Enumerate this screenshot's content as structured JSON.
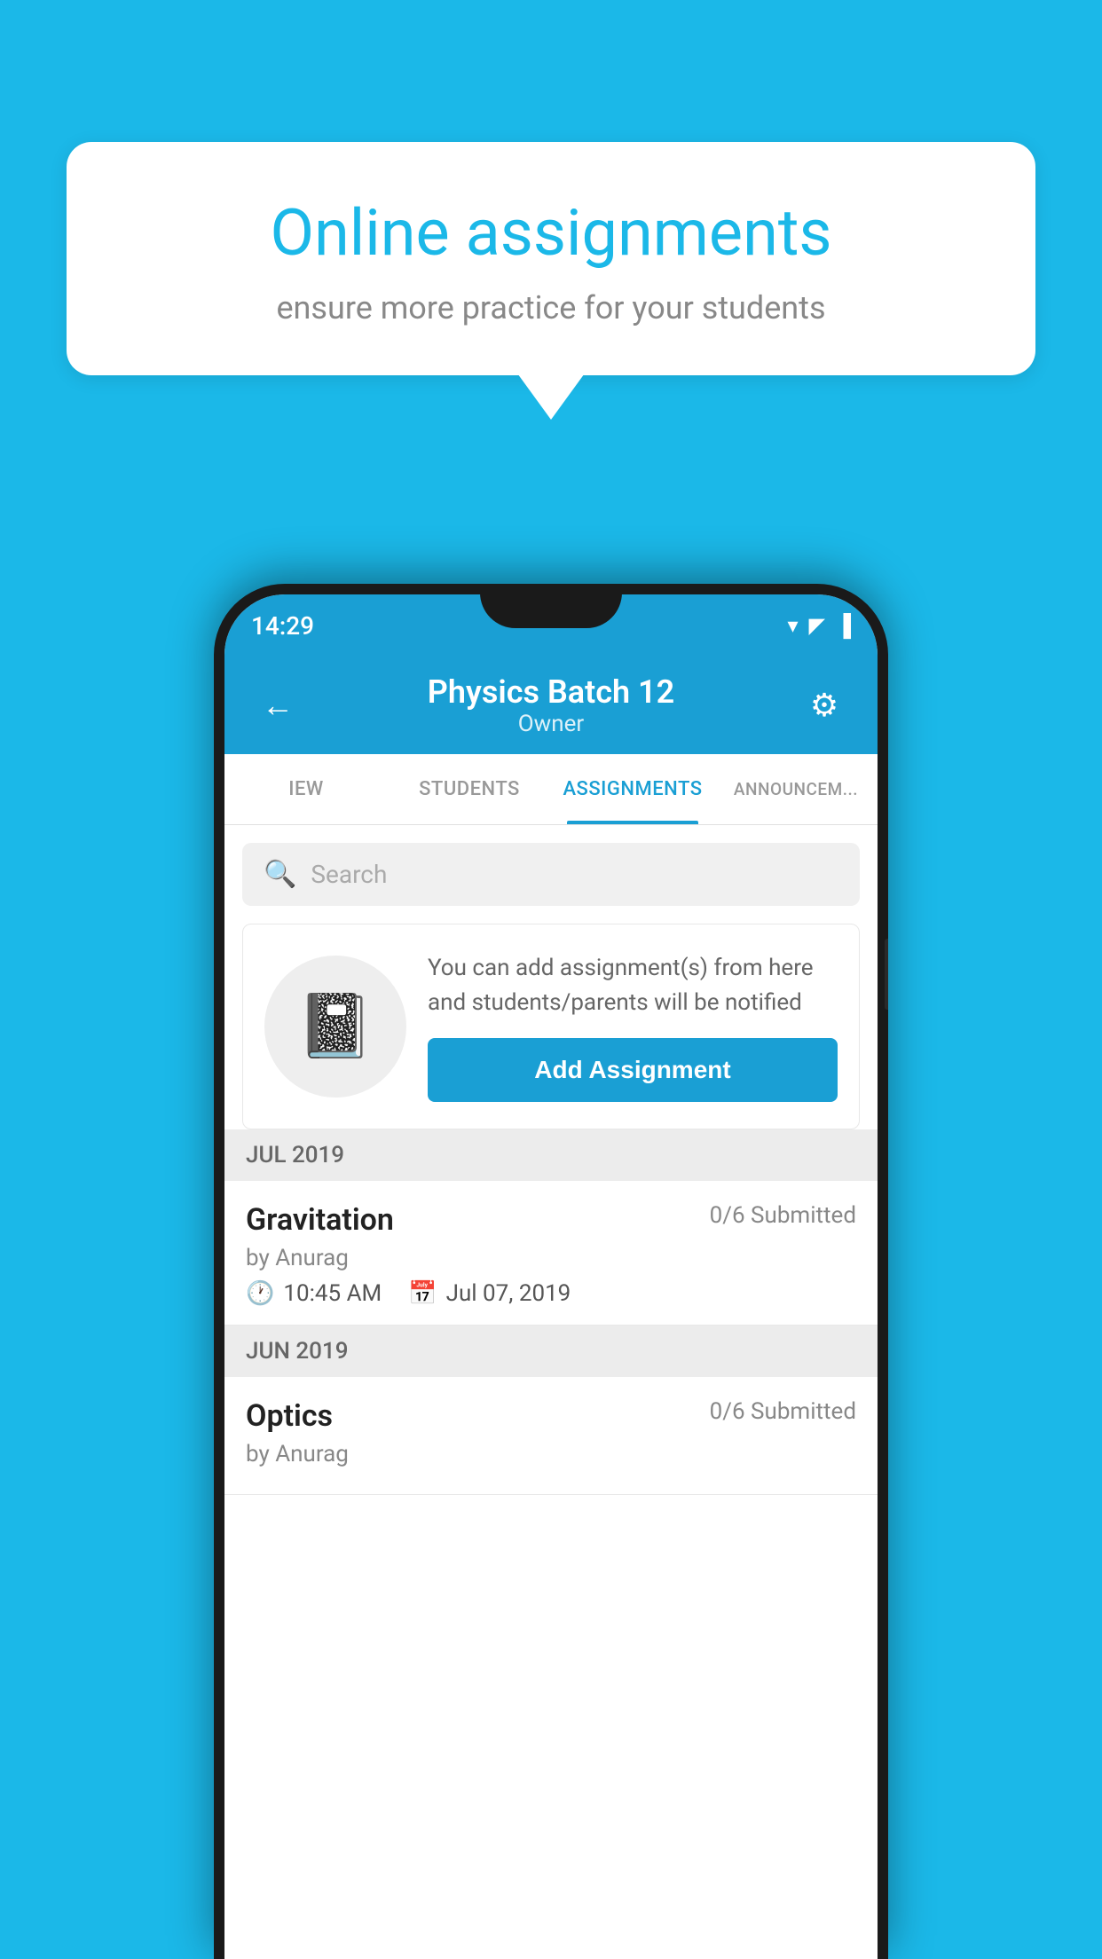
{
  "background": {
    "color": "#1bb8e8"
  },
  "speech_bubble": {
    "title": "Online assignments",
    "subtitle": "ensure more practice for your students"
  },
  "status_bar": {
    "time": "14:29",
    "wifi": "▼",
    "signal": "▲",
    "battery": "▌"
  },
  "header": {
    "title": "Physics Batch 12",
    "subtitle": "Owner",
    "back_label": "←",
    "settings_label": "⚙"
  },
  "tabs": [
    {
      "label": "IEW",
      "active": false
    },
    {
      "label": "STUDENTS",
      "active": false
    },
    {
      "label": "ASSIGNMENTS",
      "active": true
    },
    {
      "label": "ANNOUNCEM...",
      "active": false
    }
  ],
  "search": {
    "placeholder": "Search"
  },
  "empty_state": {
    "description": "You can add assignment(s) from here and students/parents will be notified",
    "button_label": "Add Assignment"
  },
  "sections": [
    {
      "label": "JUL 2019",
      "assignments": [
        {
          "name": "Gravitation",
          "submitted": "0/6 Submitted",
          "author": "by Anurag",
          "time": "10:45 AM",
          "date": "Jul 07, 2019"
        }
      ]
    },
    {
      "label": "JUN 2019",
      "assignments": [
        {
          "name": "Optics",
          "submitted": "0/6 Submitted",
          "author": "by Anurag",
          "time": "",
          "date": ""
        }
      ]
    }
  ]
}
